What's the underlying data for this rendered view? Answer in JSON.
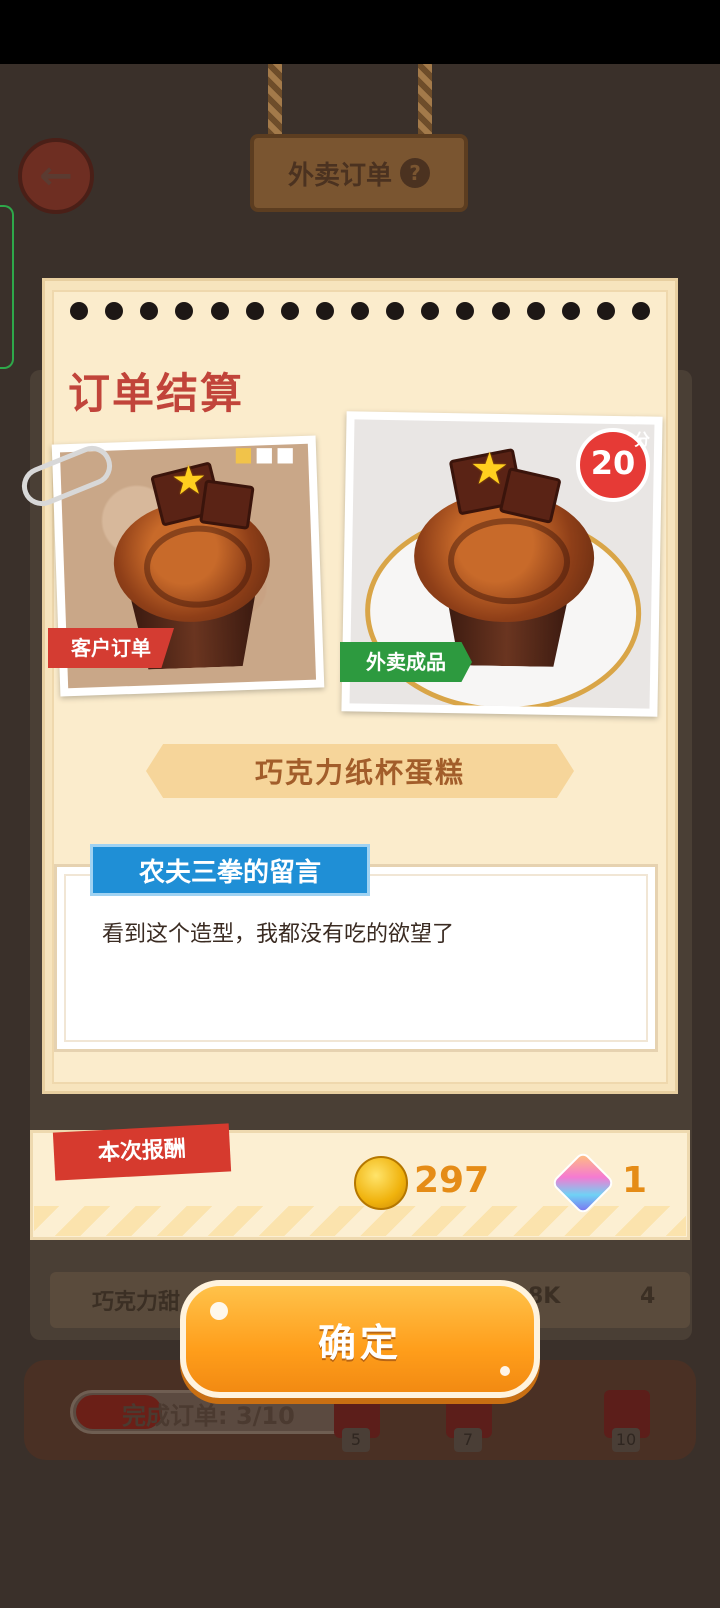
{
  "screen": {
    "title": "外卖订单",
    "help_icon": "?",
    "back_icon": "arrow-left-icon"
  },
  "card": {
    "title": "订单结算",
    "customer_tag": "客户订单",
    "delivery_tag": "外卖成品",
    "score": "20",
    "score_unit": "分",
    "dish_name": "巧克力纸杯蛋糕",
    "message_author": "农夫三拳的留言",
    "message_text": "看到这个造型，我都没有吃的欲望了"
  },
  "reward": {
    "label": "本次报酬",
    "coins": "297",
    "gems": "1",
    "coin_icon": "coin-icon",
    "gem_icon": "gem-icon"
  },
  "confirm_label": "确定",
  "background": {
    "row_name": "巧克力甜",
    "row_coin_text": "8K",
    "row_gems": "4",
    "progress_label": "完成订单: 3/10",
    "progress_value": 0.3,
    "milestones": [
      "5",
      "7",
      "10"
    ]
  }
}
